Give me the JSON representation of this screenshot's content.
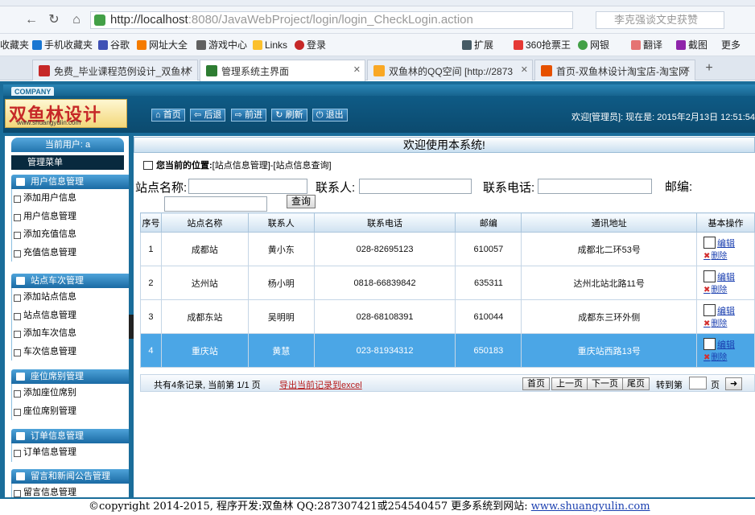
{
  "browser": {
    "url_host": "http://localhost",
    "url_rest": ":8080/JavaWebProject/login/login_CheckLogin.action",
    "search_placeholder": "李克强谈文史获赞",
    "bookmarks": [
      "收藏夹",
      "手机收藏夹",
      "谷歌",
      "网址大全",
      "游戏中心",
      "Links",
      "登录",
      "扩展",
      "360抢票王",
      "网银",
      "翻译",
      "截图",
      "更多"
    ],
    "tabs": [
      {
        "label": "免费_毕业课程范例设计_双鱼林",
        "color": "#c62828"
      },
      {
        "label": "管理系统主界面",
        "color": "#2e7d32",
        "active": true
      },
      {
        "label": "双鱼林的QQ空间 [http://2873",
        "color": "#f9a825"
      },
      {
        "label": "首页-双鱼林设计淘宝店-淘宝网",
        "color": "#e65100"
      }
    ]
  },
  "app": {
    "company": "COMPANY",
    "logo_text": "双鱼林设计",
    "logo_url": "www.shuangyulin.com",
    "menu": [
      "首页",
      "后退",
      "前进",
      "刷新",
      "退出"
    ],
    "welcome": "欢迎[管理员]: 现在是: 2015年2月13日 12:51:54"
  },
  "sidebar": {
    "user_label": "当前用户: a",
    "mgmt_menu": "管理菜单",
    "groups": [
      {
        "title": "用户信息管理",
        "items": [
          "添加用户信息",
          "用户信息管理",
          "添加充值信息",
          "充值信息管理"
        ]
      },
      {
        "title": "站点车次管理",
        "items": [
          "添加站点信息",
          "站点信息管理",
          "添加车次信息",
          "车次信息管理"
        ]
      },
      {
        "title": "座位席别管理",
        "items": [
          "添加座位席别",
          "座位席别管理"
        ]
      },
      {
        "title": "订单信息管理",
        "items": [
          "订单信息管理"
        ]
      },
      {
        "title": "留言和新闻公告管理",
        "items": [
          "留言信息管理"
        ]
      }
    ]
  },
  "main": {
    "banner": "欢迎使用本系统!",
    "breadcrumb_prefix": "您当前的位置:",
    "breadcrumb_path": "[站点信息管理]-[站点信息查询]",
    "filters": {
      "station_name": "站点名称:",
      "contact": "联系人:",
      "phone": "联系电话:",
      "postcode": "邮编:",
      "search_button": "查询"
    },
    "table": {
      "headers": [
        "序号",
        "站点名称",
        "联系人",
        "联系电话",
        "邮编",
        "通讯地址",
        "基本操作"
      ],
      "rows": [
        {
          "no": "1",
          "name": "成都站",
          "contact": "黄小东",
          "phone": "028-82695123",
          "post": "610057",
          "address": "成都北二环53号"
        },
        {
          "no": "2",
          "name": "达州站",
          "contact": "杨小明",
          "phone": "0818-66839842",
          "post": "635311",
          "address": "达州北站北路11号"
        },
        {
          "no": "3",
          "name": "成都东站",
          "contact": "吴明明",
          "phone": "028-68108391",
          "post": "610044",
          "address": "成都东三环外侧"
        },
        {
          "no": "4",
          "name": "重庆站",
          "contact": "黄慧",
          "phone": "023-81934312",
          "post": "650183",
          "address": "重庆站西路13号",
          "selected": true
        }
      ],
      "edit_label": "编辑",
      "delete_label": "删除"
    },
    "pager": {
      "info": "共有4条记录, 当前第 1/1 页",
      "export": "导出当前记录到excel",
      "first": "首页",
      "prev": "上一页",
      "next": "下一页",
      "last": "尾页",
      "goto_label": "转到第",
      "page_label": "页"
    }
  },
  "footer": {
    "text": "©copyright 2014-2015, 程序开发:双鱼林  QQ:287307421或254540457  更多系统到网站:",
    "link": "www.shuangyulin.com"
  }
}
